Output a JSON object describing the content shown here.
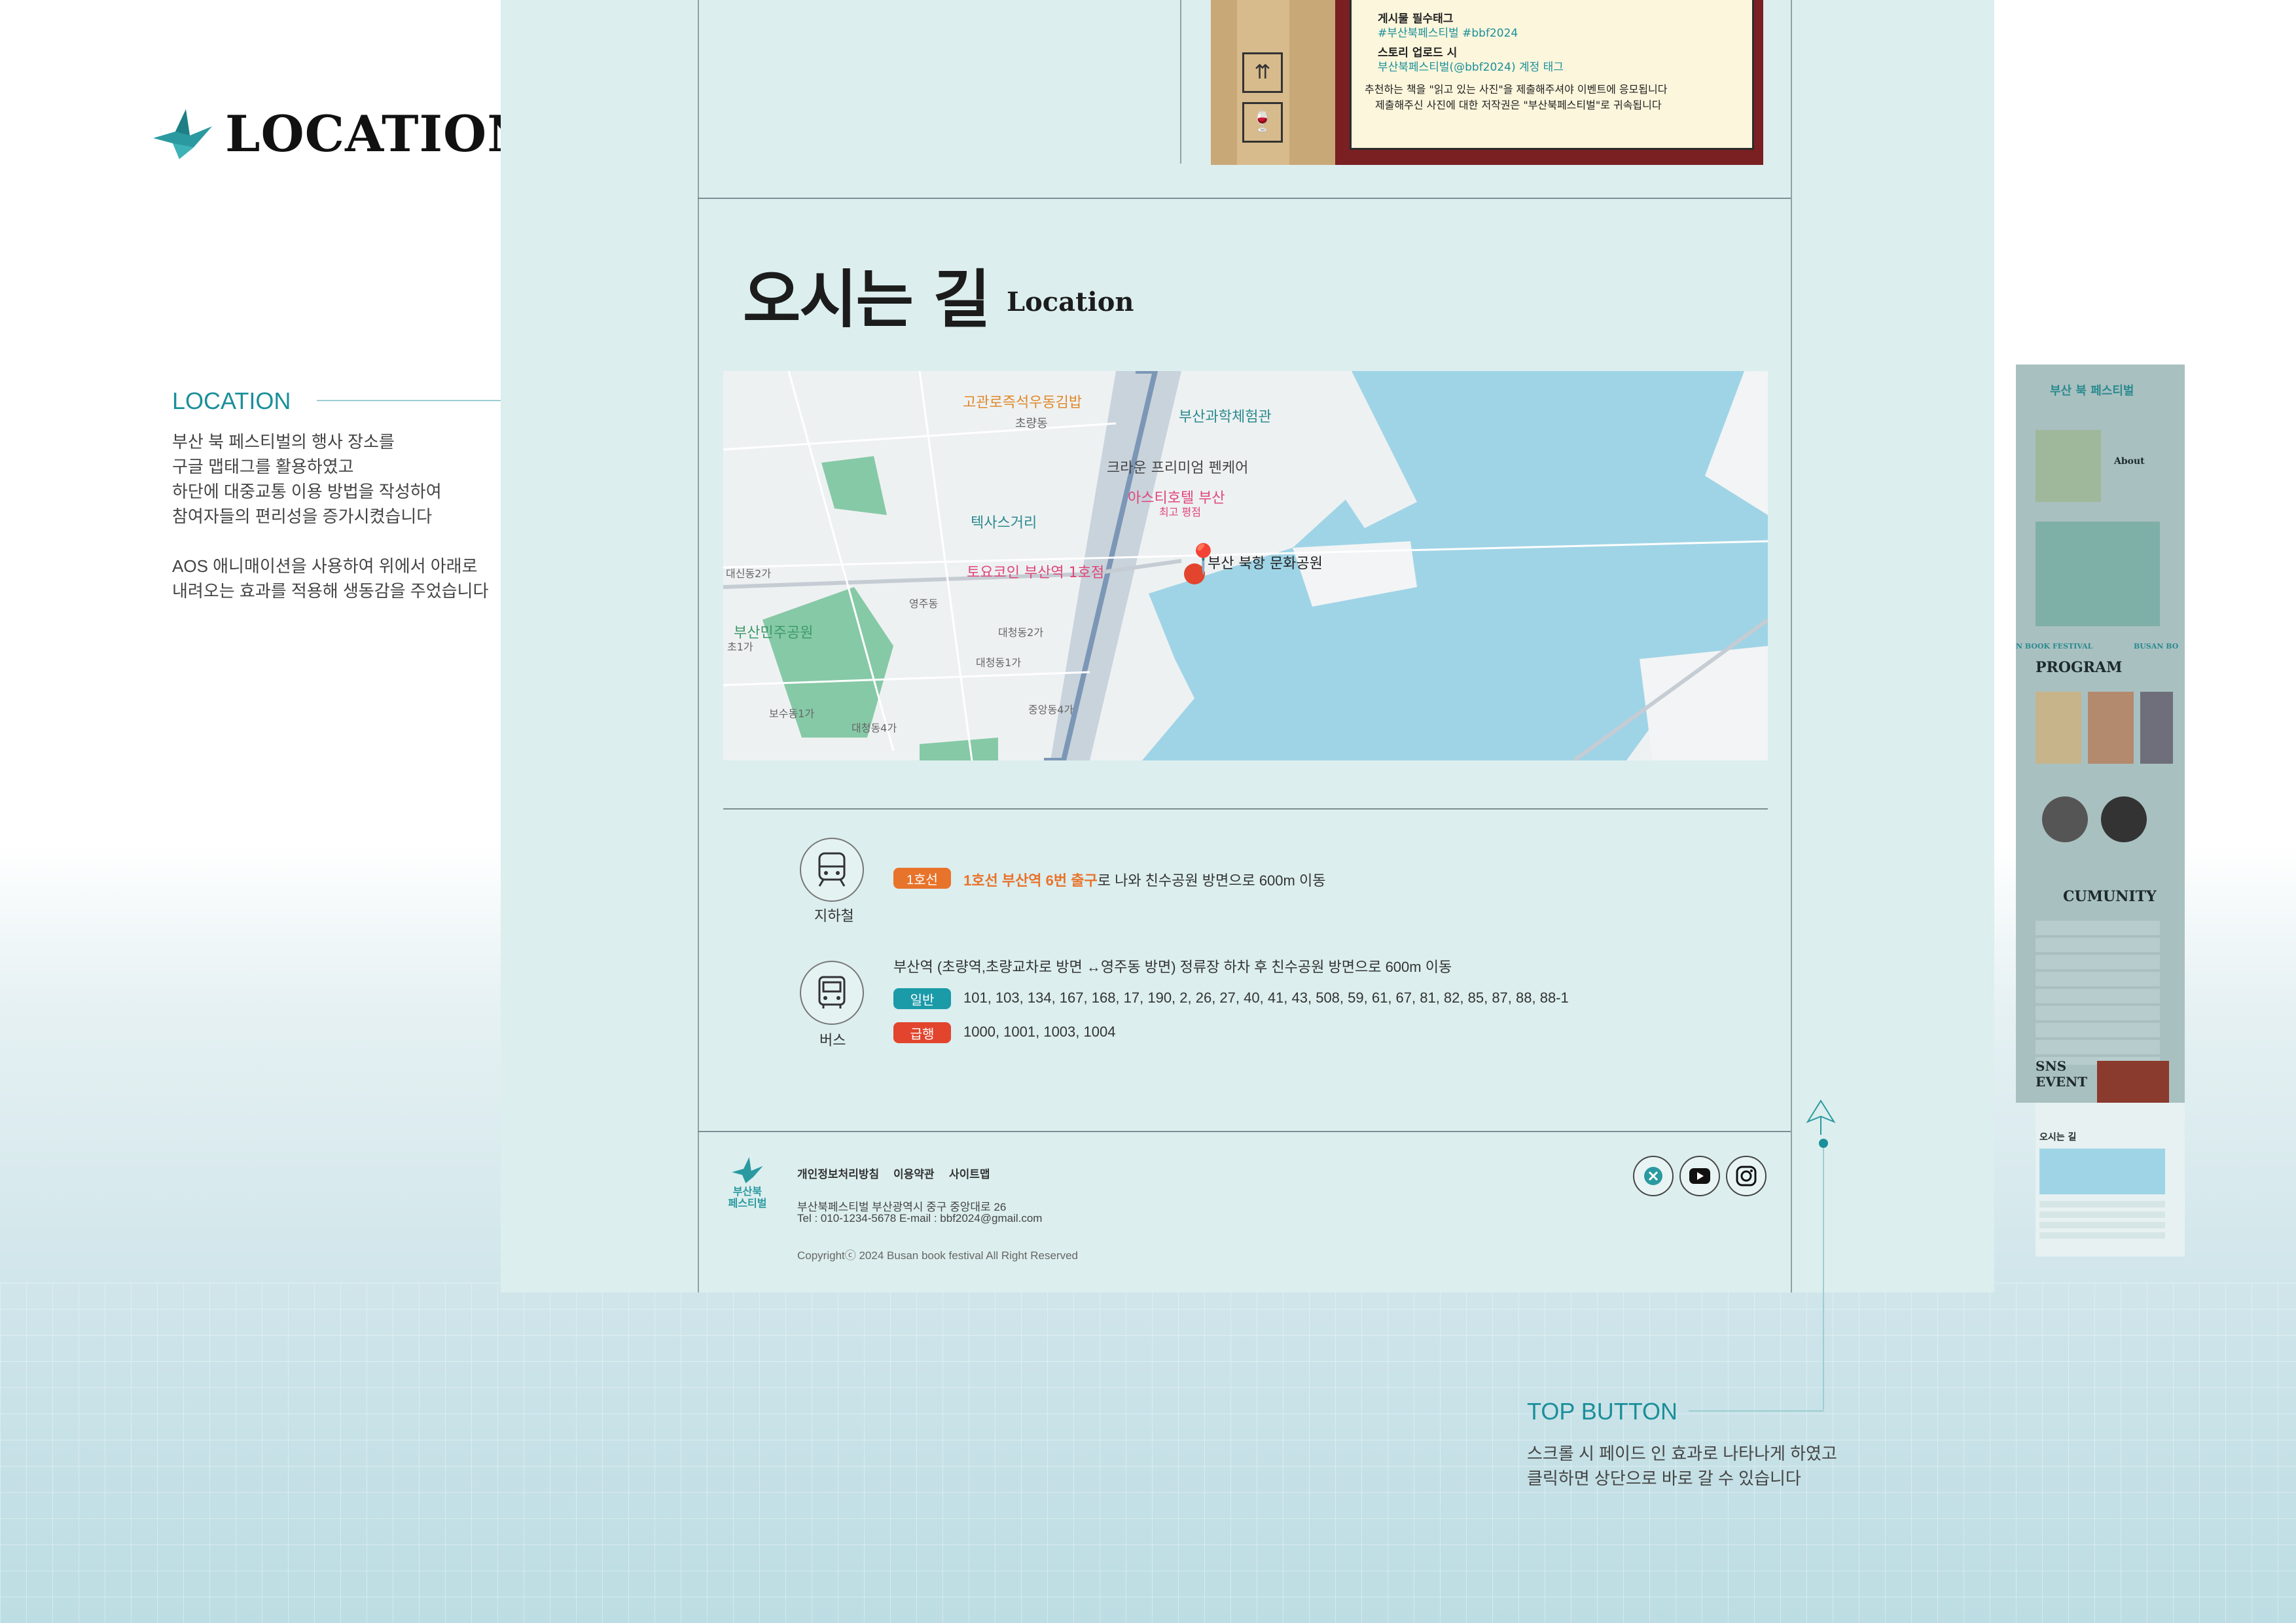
{
  "brand": {
    "title": "LOCATION"
  },
  "annotations": {
    "location": {
      "title": "LOCATION",
      "lines": [
        "부산 북 페스티벌의 행사 장소를",
        "구글 맵태그를 활용하였고",
        "하단에 대중교통 이용 방법을 작성하여",
        "참여자들의 편리성을 증가시켰습니다",
        "",
        "AOS 애니매이션을 사용하여 위에서 아래로",
        "내려오는 효과를 적용해 생동감을 주었습니다"
      ]
    },
    "top_button": {
      "title": "TOP BUTTON",
      "lines": [
        "스크롤 시 페이드 인 효과로 나타나게 하였고",
        "클릭하면 상단으로 바로 갈 수 있습니다"
      ]
    }
  },
  "event_crop": {
    "lines": [
      "게시물 필수태그",
      "#부산북페스티벌 #bbf2024",
      "스토리 업로드 시",
      "부산북페스티벌(@bbf2024) 계정 태그",
      "추천하는 책을 \"읽고 있는 사진\"을 제출해주셔야 이벤트에 응모됩니다",
      "제출해주신 사진에 대한 저작권은 \"부산북페스티벌\"로 귀속됩니다"
    ]
  },
  "section": {
    "title": "오시는 길",
    "subtitle": "Location"
  },
  "map": {
    "labels": [
      "고관로즉석우동김밥",
      "부산과학체험관",
      "초량동",
      "크라운 프리미엄 펜케어",
      "아스티호텔 부산",
      "최고 평점",
      "텍사스거리",
      "토요코인 부산역 1호점",
      "부산 북항 문화공원",
      "대신동2가",
      "부산민주공원",
      "영주동",
      "대청동2가",
      "대청동1가",
      "중앙동4가",
      "보수동1가",
      "대청동4가",
      "초1가"
    ]
  },
  "transport": {
    "subway": {
      "label": "지하철",
      "badge": "1호선",
      "highlight": "1호선 부산역 6번 출구",
      "text": "로 나와 친수공원 방면으로 600m 이동"
    },
    "bus": {
      "label": "버스",
      "desc": "부산역 (초량역,초량교차로 방면 ↔영주동 방면) 정류장 하차 후 친수공원 방면으로 600m 이동",
      "general_badge": "일반",
      "general_routes": "101, 103, 134, 167, 168, 17, 190, 2, 26, 27, 40, 41, 43, 508, 59, 61, 67, 81, 82, 85, 87, 88, 88-1",
      "express_badge": "급행",
      "express_routes": "1000, 1001, 1003, 1004"
    }
  },
  "footer": {
    "logo_text": "부산북\n페스티벌",
    "links": [
      "개인정보처리방침",
      "이용약관",
      "사이트맵"
    ],
    "address": "부산북페스티벌    부산광역시 중구 중앙대로 26",
    "contact": "Tel : 010-1234-5678      E-mail : bbf2024@gmail.com",
    "copyright": "Copyrightⓒ 2024 Busan book festival All Right Reserved"
  },
  "thumbnail": {
    "texts": [
      "부산 북 페스티벌",
      "About",
      "N BOOK FESTIVAL",
      "BUSAN BO",
      "PROGRAM",
      "CUMUNITY",
      "SNS",
      "EVENT",
      "오시는 길"
    ]
  },
  "colors": {
    "teal": "#1b8f9a",
    "orange": "#e8732a",
    "red": "#e2442d",
    "panel": "#dceeee"
  }
}
